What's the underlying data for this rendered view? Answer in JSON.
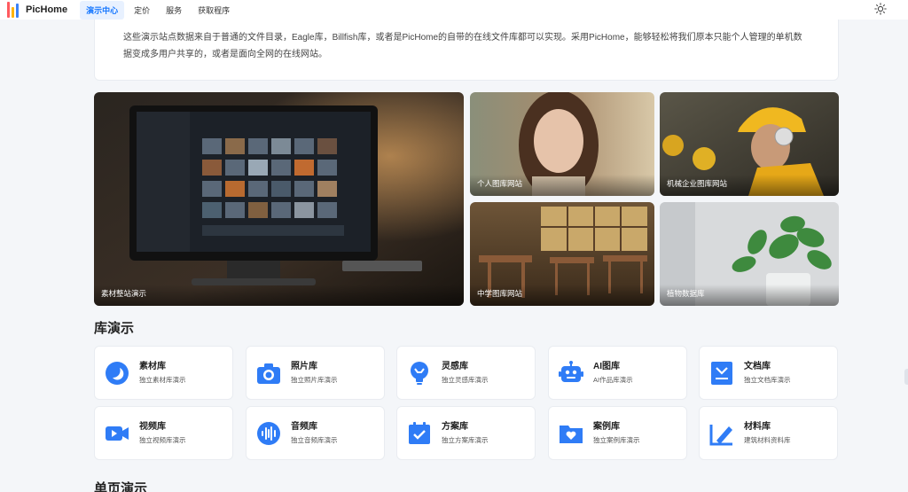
{
  "app": {
    "name": "PicHome"
  },
  "nav": {
    "items": [
      "演示中心",
      "定价",
      "服务",
      "获取程序"
    ],
    "active": 0
  },
  "intro": {
    "line1": "这些演示站点数据来自于普通的文件目录，Eagle库，Billfish库，或者是PicHome的自带的在线文件库都可以实现。采用PicHome，能够轻松将我们原本只能个人管理的单机数",
    "line2": "据变成多用户共享的，或者是面向全网的在线网站。"
  },
  "gallery": {
    "main": "素材整站演示",
    "tiles": [
      "个人图库网站",
      "机械企业图库网站",
      "中学图库网站",
      "植物数据库"
    ]
  },
  "library_section": {
    "title": "库演示"
  },
  "libraries": [
    {
      "title": "素材库",
      "desc": "独立素材库演示",
      "icon": "moon-icon"
    },
    {
      "title": "照片库",
      "desc": "独立照片库演示",
      "icon": "camera-icon"
    },
    {
      "title": "灵感库",
      "desc": "独立灵感库演示",
      "icon": "bulb-icon"
    },
    {
      "title": "AI图库",
      "desc": "AI作品库演示",
      "icon": "robot-icon"
    },
    {
      "title": "文档库",
      "desc": "独立文档库演示",
      "icon": "document-icon"
    },
    {
      "title": "视频库",
      "desc": "独立视频库演示",
      "icon": "video-icon"
    },
    {
      "title": "音频库",
      "desc": "独立音频库演示",
      "icon": "audio-icon"
    },
    {
      "title": "方案库",
      "desc": "独立方案库演示",
      "icon": "plan-icon"
    },
    {
      "title": "案例库",
      "desc": "独立案例库演示",
      "icon": "case-icon"
    },
    {
      "title": "材料库",
      "desc": "建筑材料资料库",
      "icon": "material-icon"
    }
  ],
  "single_section": {
    "title": "单页演示"
  },
  "colors": {
    "accent": "#1677ff",
    "icon_blue": "#2f7cf6"
  }
}
